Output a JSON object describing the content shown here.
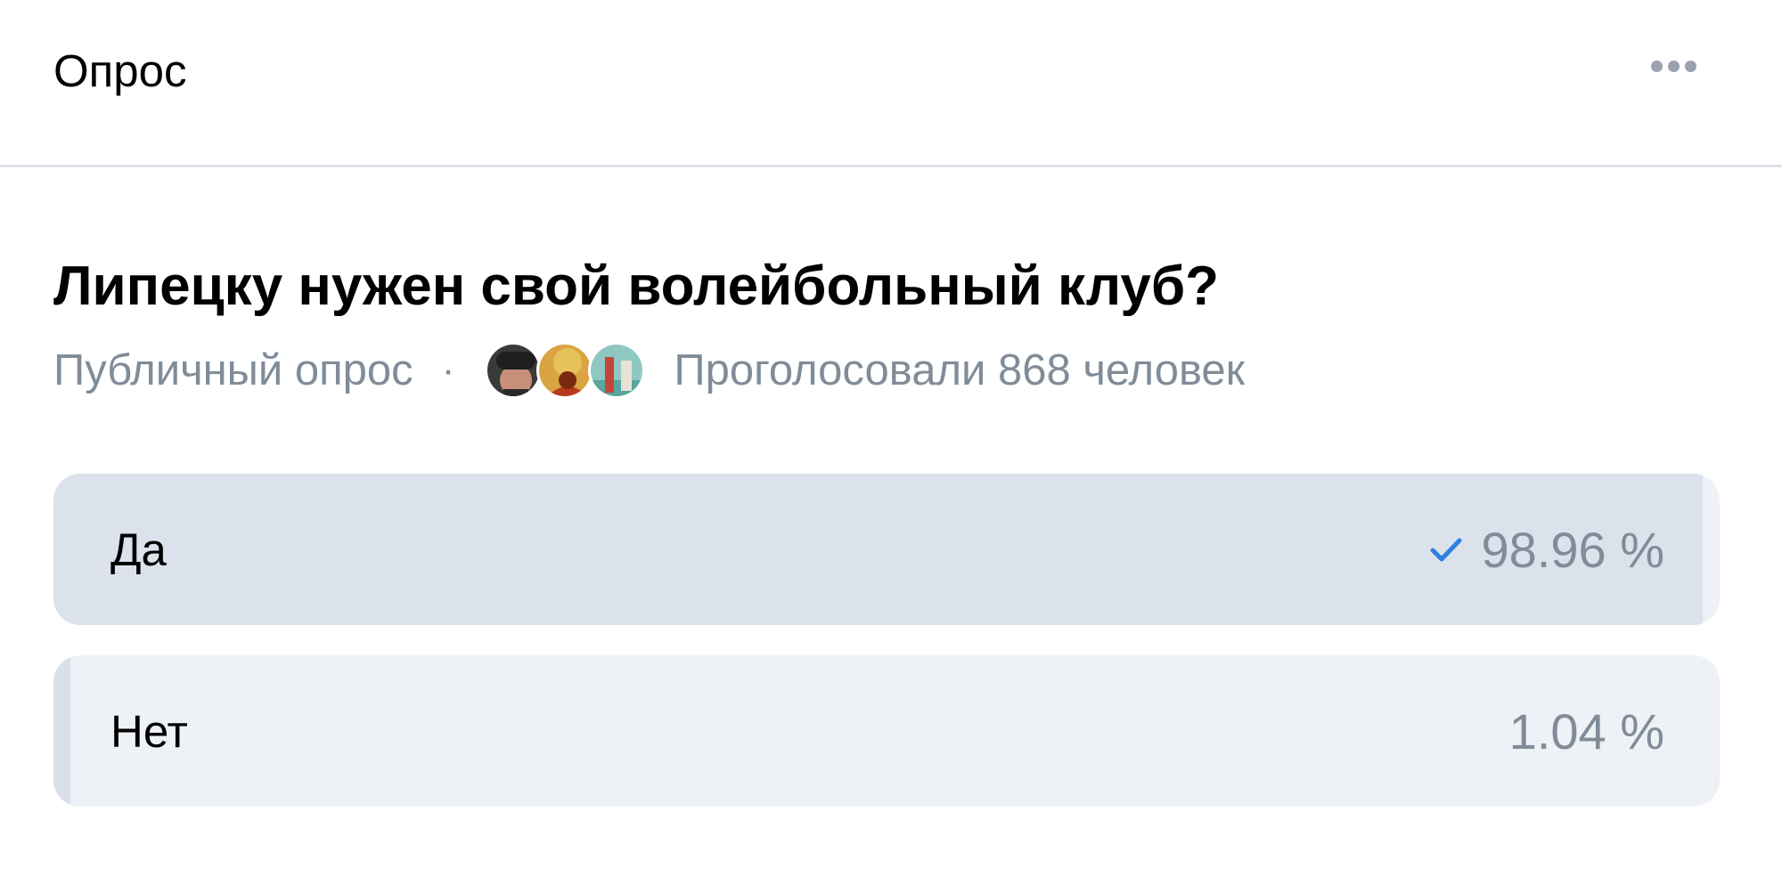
{
  "header": {
    "title": "Опрос",
    "more_icon": "more-horizontal-icon"
  },
  "poll": {
    "question": "Липецку нужен свой волейбольный клуб?",
    "type_label": "Публичный опрос",
    "separator": "·",
    "voters_text": "Проголосовали 868 человек",
    "voter_avatars": [
      "voter-avatar-1",
      "voter-avatar-2",
      "voter-avatar-3"
    ],
    "options": [
      {
        "label": "Да",
        "result": "98.96 %",
        "percent": 98.96,
        "voted": true,
        "check_icon": "checkmark-icon"
      },
      {
        "label": "Нет",
        "result": "1.04 %",
        "percent": 1.04,
        "voted": false
      }
    ]
  },
  "colors": {
    "accent": "#2d81e0",
    "secondary_text": "#818c99",
    "option_bg": "#eef1f5",
    "option_fill": "#dbe2ec",
    "divider": "#dce1e8"
  }
}
